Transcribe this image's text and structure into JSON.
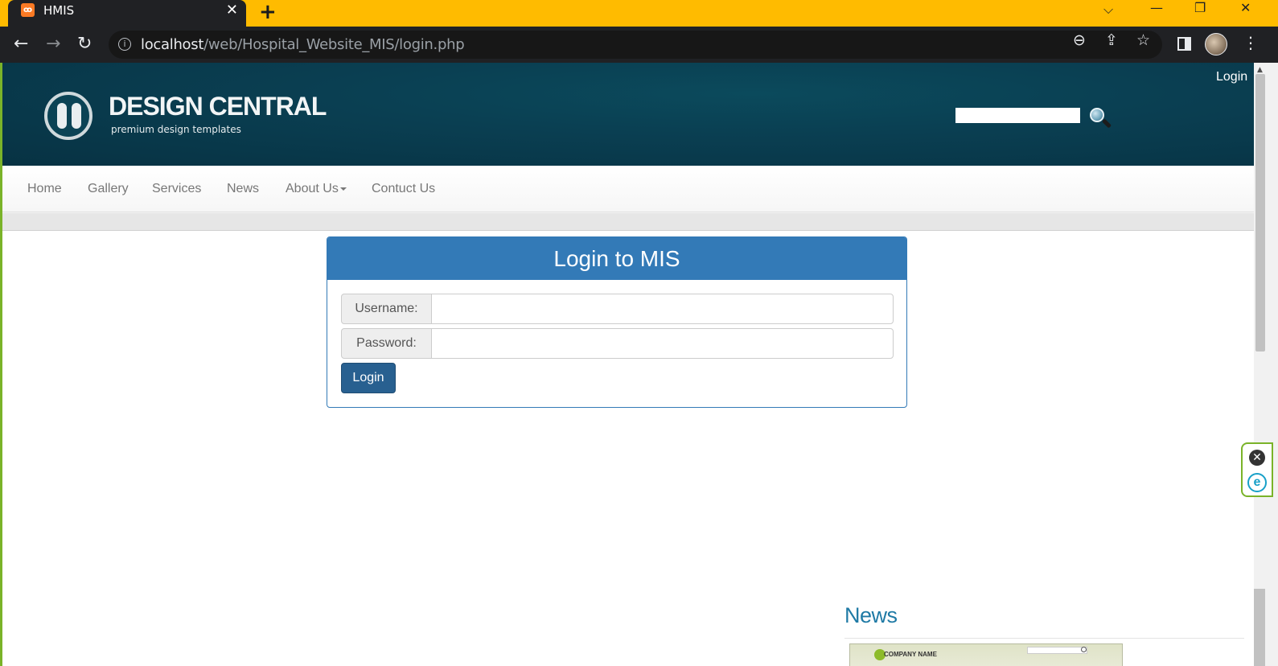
{
  "browser": {
    "tab_title": "HMIS",
    "tab_favicon_text": "ꚙ",
    "close_glyph": "✕",
    "new_tab_glyph": "+",
    "url_host": "localhost",
    "url_path": "/web/Hospital_Website_MIS/login.php",
    "controls": {
      "dropdown": "⌵",
      "minimize": "—",
      "restore": "❐",
      "close": "✕"
    },
    "nav": {
      "back": "←",
      "forward": "→",
      "reload": "↻"
    },
    "omnibox_icons": {
      "zoom": "⊖",
      "share": "⇪",
      "bookmark": "☆"
    },
    "menu": "⋮",
    "info": "i",
    "accent_color": "#ffbb00"
  },
  "site": {
    "brand": "DESIGN CENTRAL",
    "tagline": "premium design templates",
    "top_login": "Login",
    "search_placeholder": "",
    "header_color": "#0a3f52"
  },
  "nav": {
    "items": [
      {
        "label": "Home"
      },
      {
        "label": "Gallery"
      },
      {
        "label": "Services"
      },
      {
        "label": "News"
      },
      {
        "label": "About Us"
      },
      {
        "label": "Contuct Us"
      }
    ]
  },
  "login": {
    "heading": "Login to MIS",
    "username_label": "Username:",
    "username_value": "",
    "password_label": "Password:",
    "password_value": "",
    "button": "Login",
    "primary_color": "#337ab7"
  },
  "news": {
    "title": "News",
    "thumb_company": "COMPANY NAME"
  },
  "widget": {
    "close": "✕",
    "badge": "e"
  }
}
